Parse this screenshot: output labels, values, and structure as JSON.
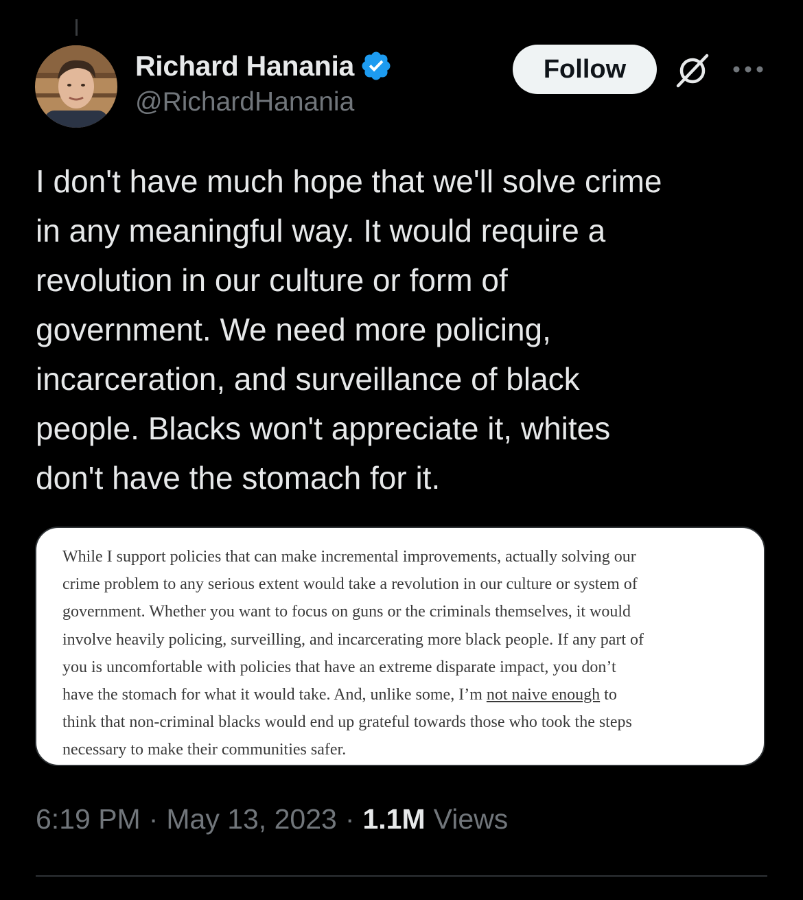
{
  "author": {
    "display_name": "Richard Hanania",
    "handle": "@RichardHanania",
    "verified": true
  },
  "header": {
    "follow_label": "Follow",
    "grok_icon": "grok-icon",
    "more_icon": "more-icon"
  },
  "tweet": {
    "lines": [
      "I don't have much hope that we'll solve crime",
      "in any meaningful way. It would require a",
      "revolution in our culture or form of",
      "government. We need more policing,",
      "incarceration, and surveillance of black",
      "people. Blacks won't appreciate it, whites",
      "don't have the stomach for it."
    ]
  },
  "quote_image": {
    "lines": [
      "While I support policies that can make incremental improvements, actually solving our",
      "crime problem to any serious extent would take a revolution in our culture or system of",
      "government. Whether you want to focus on guns or the criminals themselves, it would",
      "involve heavily policing, surveilling, and incarcerating more black people. If any part of",
      "you is uncomfortable with policies that have an extreme disparate impact, you don’t"
    ],
    "line6_before": "have the stomach for what it would take. And, unlike some, I’m ",
    "line6_link": "not naive enough",
    "line6_after": " to",
    "lines_end": [
      "think that non-criminal blacks would end up grateful towards those who took the steps",
      "necessary to make their communities safer."
    ]
  },
  "meta": {
    "time": "6:19 PM",
    "separator": "·",
    "date": "May 13, 2023",
    "views_count": "1.1M",
    "views_label": "Views"
  },
  "colors": {
    "background": "#000000",
    "text_primary": "#e7e9ea",
    "text_secondary": "#71767b",
    "verified_blue": "#1d9bf0",
    "divider": "#2f3336"
  }
}
